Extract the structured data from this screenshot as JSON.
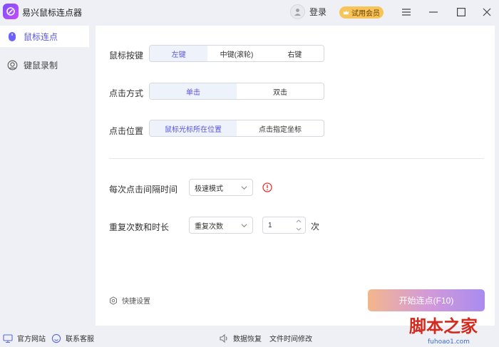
{
  "app": {
    "title": "易兴鼠标连点器"
  },
  "header": {
    "login": "登录",
    "vip": "试用会员"
  },
  "sidebar": {
    "items": [
      {
        "label": "鼠标连点"
      },
      {
        "label": "键鼠录制"
      }
    ]
  },
  "mouse_button": {
    "label": "鼠标按键",
    "options": [
      "左键",
      "中键(滚轮)",
      "右键"
    ],
    "selected": "左键"
  },
  "click_mode": {
    "label": "点击方式",
    "options": [
      "单击",
      "双击"
    ],
    "selected": "单击"
  },
  "click_position": {
    "label": "点击位置",
    "options": [
      "鼠标光标所在位置",
      "点击指定坐标"
    ],
    "selected": "鼠标光标所在位置"
  },
  "interval": {
    "label": "每次点击间隔时间",
    "value": "极速模式"
  },
  "repeat": {
    "label": "重复次数和时长",
    "mode": "重复次数",
    "count": "1",
    "unit": "次"
  },
  "hotkey": {
    "label": "快捷设置"
  },
  "start_button": {
    "label": "开始连点(F10)"
  },
  "footer": {
    "website": "官方网站",
    "support": "联系客服",
    "data_recovery": "数据恢复",
    "file_time": "文件时间修改"
  },
  "watermark": {
    "text": "脚本之家",
    "site": "fuhoao1.com"
  },
  "colors": {
    "accent": "#5a55e0",
    "vip": "#f7c45a",
    "panel": "#ffffff",
    "background": "#eef0f5"
  }
}
